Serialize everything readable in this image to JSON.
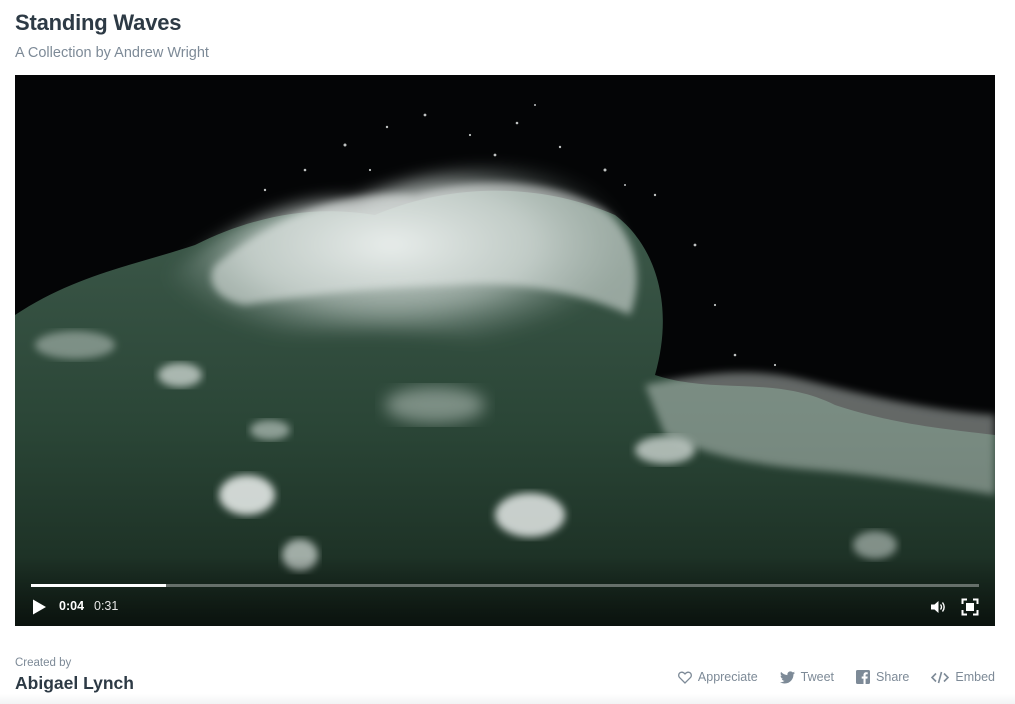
{
  "header": {
    "title": "Standing Waves",
    "subtitle": "A Collection by Andrew Wright"
  },
  "video": {
    "current_time": "0:04",
    "duration": "0:31",
    "progress": 0.142,
    "play_icon": "play-icon",
    "volume_icon": "volume-icon",
    "fullscreen_icon": "fullscreen-icon"
  },
  "footer": {
    "created_by_label": "Created by",
    "creator_name": "Abigael Lynch",
    "actions": [
      {
        "label": "Appreciate",
        "icon": "heart-icon"
      },
      {
        "label": "Tweet",
        "icon": "twitter-icon"
      },
      {
        "label": "Share",
        "icon": "facebook-icon"
      },
      {
        "label": "Embed",
        "icon": "code-icon"
      }
    ]
  },
  "colors": {
    "title": "#2d3a45",
    "muted": "#7d8a97",
    "video_background": "#040506",
    "water_green": "#2f4a3a",
    "foam": "#e8ecea"
  }
}
